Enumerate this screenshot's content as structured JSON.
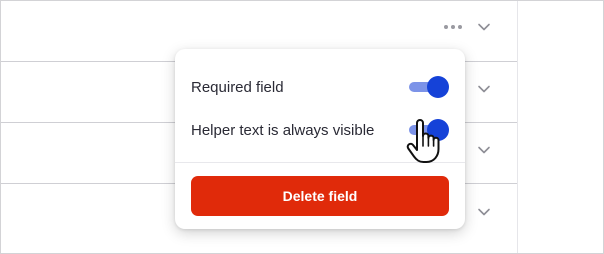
{
  "fields_list": {
    "row_count": 4,
    "more_icon": "more-horizontal-icon",
    "expand_icon": "chevron-down-icon"
  },
  "field_menu": {
    "required_label": "Required field",
    "required_on": true,
    "helper_label": "Helper text is always visible",
    "helper_on": true,
    "delete_label": "Delete field"
  },
  "colors": {
    "toggle_knob": "#1542d8",
    "toggle_track": "#7c93e8",
    "delete_button": "#e02a0a"
  },
  "cursor_icon": "hand-pointer-icon"
}
